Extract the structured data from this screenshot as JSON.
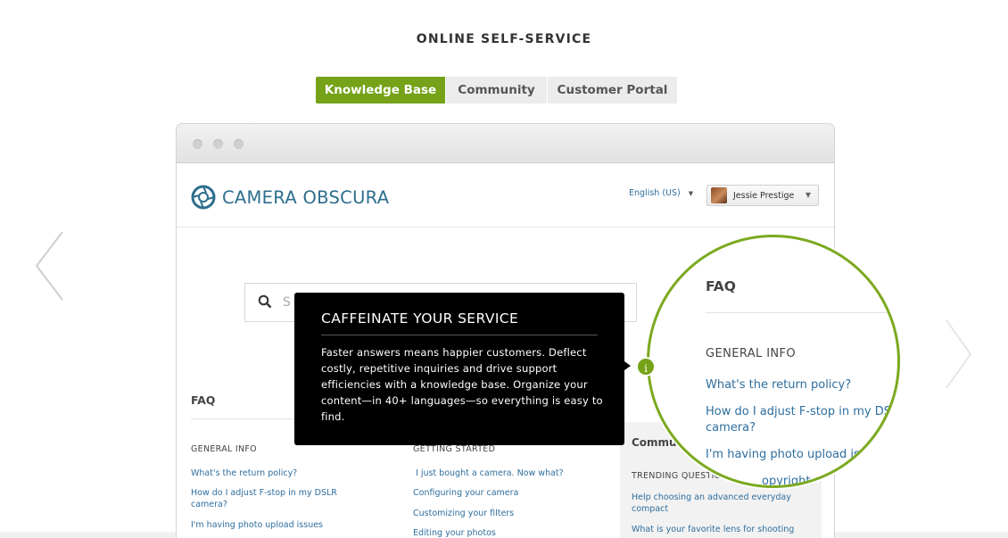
{
  "section_title": "ONLINE SELF-SERVICE",
  "tabs": [
    {
      "label": "Knowledge Base",
      "active": true
    },
    {
      "label": "Community",
      "active": false
    },
    {
      "label": "Customer Portal",
      "active": false
    }
  ],
  "site": {
    "logo_text": "CAMERA OBSCURA",
    "language": "English (US)",
    "user_name": "Jessie Prestige",
    "search_placeholder": "S"
  },
  "faq": {
    "heading": "FAQ",
    "general_info": {
      "heading": "GENERAL INFO",
      "links": [
        "What's the return policy?",
        "How do I adjust F-stop in my DSLR camera?",
        "I'm having photo upload issues"
      ]
    },
    "getting_started": {
      "heading": "GETTING STARTED",
      "links": [
        "I just bought a camera. Now what?",
        "Configuring your camera",
        "Customizing your filters",
        "Editing your photos"
      ]
    }
  },
  "community": {
    "heading": "Commu",
    "trending_heading": "TRENDING QUESTIO",
    "links": [
      "Help choosing an advanced everyday compact",
      "What is your favorite lens for shooting"
    ]
  },
  "tooltip": {
    "title": "CAFFEINATE YOUR SERVICE",
    "body": "Faster answers means happier customers. Deflect costly, repetitive inquiries and drive support efficiencies with a knowledge base. Organize your content—in 40+ languages—so everything is easy to find.",
    "icon_label": "i"
  },
  "magnifier": {
    "heading": "FAQ",
    "subheading": "GENERAL INFO",
    "links": [
      "What's the return policy?",
      "How do I adjust F-stop in my DSLR",
      "camera?",
      "I'm having photo upload issues",
      "opyright and image"
    ]
  },
  "colors": {
    "accent_green": "#75a218",
    "link_blue": "#2e6e9e",
    "logo_blue": "#2e6e8e"
  }
}
